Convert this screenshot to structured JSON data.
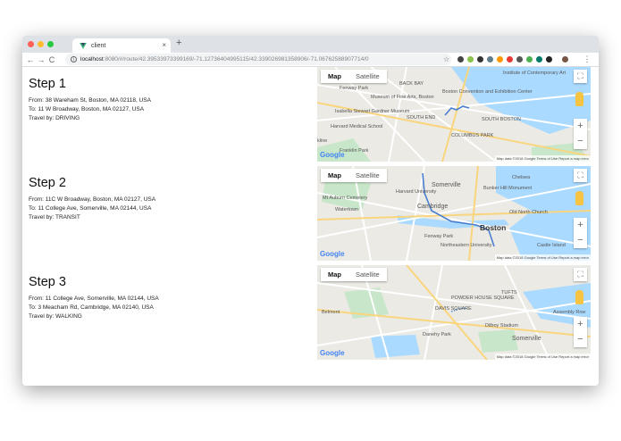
{
  "browser": {
    "tab_title": "client",
    "new_tab": "+",
    "close_tab": "×",
    "url_host": "localhost",
    "url_rest": ":8080/#/route/42.39533973399169/-71.12736404995115/42.339026981358906/-71.06762588907714/0",
    "back": "←",
    "forward": "→",
    "reload": "C",
    "bookmark": "☆",
    "menu": "⋮",
    "traffic_colors": [
      "#ff5f57",
      "#febc2e",
      "#28c840"
    ]
  },
  "map_controls": {
    "map_label": "Map",
    "satellite_label": "Satellite",
    "fullscreen": "⛶",
    "zoom_in": "+",
    "zoom_out": "−",
    "google": "Google",
    "attribution": "Map data ©2018 Google   Terms of Use   Report a map error"
  },
  "steps": [
    {
      "title": "Step 1",
      "from": "From: 38 Wareham St, Boston, MA 02118, USA",
      "to": "To: 11 W Broadway, Boston, MA 02127, USA",
      "travel": "Travel by: DRIVING",
      "map_labels": [
        "Fenway Park",
        "BACK BAY",
        "SOUTH END",
        "SOUTH BOSTON",
        "Harvard Medical School",
        "Museum of Fine Arts, Boston",
        "Boston Convention and Exhibition Center",
        "Institute of Contemporary Art",
        "COLUMBUS PARK",
        "Franklin Park",
        "Isabella Stewart Gardner Museum",
        "kline"
      ]
    },
    {
      "title": "Step 2",
      "from": "From: 11C W Broadway, Boston, MA 02127, USA",
      "to": "To: 11 College Ave, Somerville, MA 02144, USA",
      "travel": "Travel by: TRANSIT",
      "map_labels": [
        "Somerville",
        "Cambridge",
        "Boston",
        "Watertown",
        "Harvard University",
        "Mt Auburn Cemetery",
        "Bunker Hill Monument",
        "Old North Church",
        "Chelsea",
        "Fenway Park",
        "Northeastern University",
        "Castle Island"
      ]
    },
    {
      "title": "Step 3",
      "from": "From: 11 College Ave, Somerville, MA 02144, USA",
      "to": "To: 3 Meacham Rd, Cambridge, MA 02140, USA",
      "travel": "Travel by: WALKING",
      "map_labels": [
        "POWDER HOUSE SQUARE",
        "DAVIS SQUARE",
        "Somerville",
        "Belmont",
        "Danehy Park",
        "Assembly Row",
        "Dilboy Stadium",
        "TUFTS"
      ]
    }
  ]
}
